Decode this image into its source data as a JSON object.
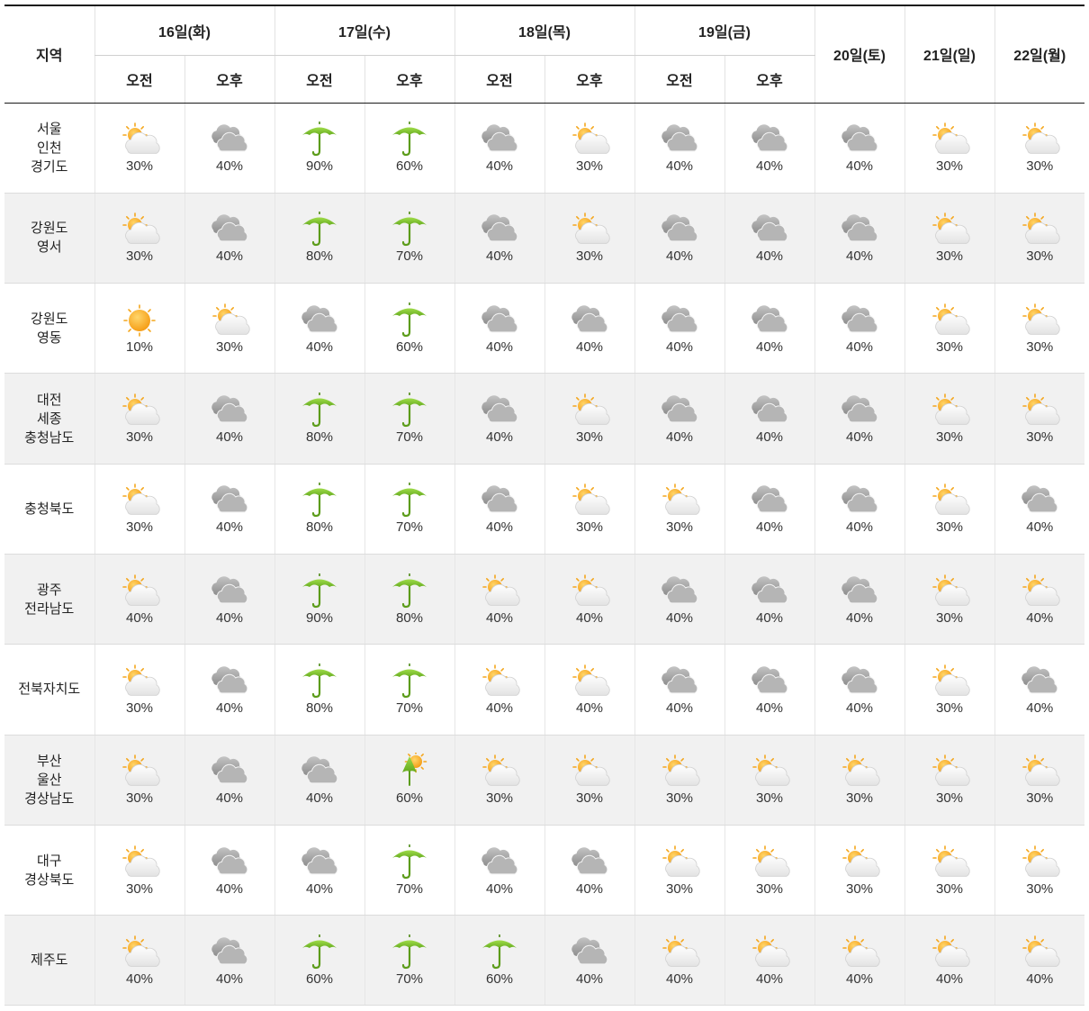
{
  "header": {
    "region_label": "지역",
    "days": [
      {
        "label": "16일(화)",
        "split": true
      },
      {
        "label": "17일(수)",
        "split": true
      },
      {
        "label": "18일(목)",
        "split": true
      },
      {
        "label": "19일(금)",
        "split": true
      },
      {
        "label": "20일(토)",
        "split": false
      },
      {
        "label": "21일(일)",
        "split": false
      },
      {
        "label": "22일(월)",
        "split": false
      }
    ],
    "am_label": "오전",
    "pm_label": "오후"
  },
  "icons": {
    "partly-cloudy": "partly-cloudy-icon",
    "cloudy": "cloudy-icon",
    "rain": "umbrella-icon",
    "sunny": "sun-icon",
    "shower": "umbrella-sun-icon"
  },
  "colors": {
    "header_rule": "#1a1a1a",
    "row_alt": "#f1f1f1",
    "umbrella_green": "#7dc42a",
    "sun_orange": "#f7a21b",
    "cloud_gray": "#a9a9a9"
  },
  "rows": [
    {
      "region": [
        "서울",
        "인천",
        "경기도"
      ],
      "cells": [
        {
          "icon": "partly-cloudy",
          "prob": "30%"
        },
        {
          "icon": "cloudy",
          "prob": "40%"
        },
        {
          "icon": "rain",
          "prob": "90%"
        },
        {
          "icon": "rain",
          "prob": "60%"
        },
        {
          "icon": "cloudy",
          "prob": "40%"
        },
        {
          "icon": "partly-cloudy",
          "prob": "30%"
        },
        {
          "icon": "cloudy",
          "prob": "40%"
        },
        {
          "icon": "cloudy",
          "prob": "40%"
        },
        {
          "icon": "cloudy",
          "prob": "40%"
        },
        {
          "icon": "partly-cloudy",
          "prob": "30%"
        },
        {
          "icon": "partly-cloudy",
          "prob": "30%"
        }
      ]
    },
    {
      "region": [
        "강원도",
        "영서"
      ],
      "cells": [
        {
          "icon": "partly-cloudy",
          "prob": "30%"
        },
        {
          "icon": "cloudy",
          "prob": "40%"
        },
        {
          "icon": "rain",
          "prob": "80%"
        },
        {
          "icon": "rain",
          "prob": "70%"
        },
        {
          "icon": "cloudy",
          "prob": "40%"
        },
        {
          "icon": "partly-cloudy",
          "prob": "30%"
        },
        {
          "icon": "cloudy",
          "prob": "40%"
        },
        {
          "icon": "cloudy",
          "prob": "40%"
        },
        {
          "icon": "cloudy",
          "prob": "40%"
        },
        {
          "icon": "partly-cloudy",
          "prob": "30%"
        },
        {
          "icon": "partly-cloudy",
          "prob": "30%"
        }
      ]
    },
    {
      "region": [
        "강원도",
        "영동"
      ],
      "cells": [
        {
          "icon": "sunny",
          "prob": "10%"
        },
        {
          "icon": "partly-cloudy",
          "prob": "30%"
        },
        {
          "icon": "cloudy",
          "prob": "40%"
        },
        {
          "icon": "rain",
          "prob": "60%"
        },
        {
          "icon": "cloudy",
          "prob": "40%"
        },
        {
          "icon": "cloudy",
          "prob": "40%"
        },
        {
          "icon": "cloudy",
          "prob": "40%"
        },
        {
          "icon": "cloudy",
          "prob": "40%"
        },
        {
          "icon": "cloudy",
          "prob": "40%"
        },
        {
          "icon": "partly-cloudy",
          "prob": "30%"
        },
        {
          "icon": "partly-cloudy",
          "prob": "30%"
        }
      ]
    },
    {
      "region": [
        "대전",
        "세종",
        "충청남도"
      ],
      "cells": [
        {
          "icon": "partly-cloudy",
          "prob": "30%"
        },
        {
          "icon": "cloudy",
          "prob": "40%"
        },
        {
          "icon": "rain",
          "prob": "80%"
        },
        {
          "icon": "rain",
          "prob": "70%"
        },
        {
          "icon": "cloudy",
          "prob": "40%"
        },
        {
          "icon": "partly-cloudy",
          "prob": "30%"
        },
        {
          "icon": "cloudy",
          "prob": "40%"
        },
        {
          "icon": "cloudy",
          "prob": "40%"
        },
        {
          "icon": "cloudy",
          "prob": "40%"
        },
        {
          "icon": "partly-cloudy",
          "prob": "30%"
        },
        {
          "icon": "partly-cloudy",
          "prob": "30%"
        }
      ]
    },
    {
      "region": [
        "충청북도"
      ],
      "cells": [
        {
          "icon": "partly-cloudy",
          "prob": "30%"
        },
        {
          "icon": "cloudy",
          "prob": "40%"
        },
        {
          "icon": "rain",
          "prob": "80%"
        },
        {
          "icon": "rain",
          "prob": "70%"
        },
        {
          "icon": "cloudy",
          "prob": "40%"
        },
        {
          "icon": "partly-cloudy",
          "prob": "30%"
        },
        {
          "icon": "partly-cloudy",
          "prob": "30%"
        },
        {
          "icon": "cloudy",
          "prob": "40%"
        },
        {
          "icon": "cloudy",
          "prob": "40%"
        },
        {
          "icon": "partly-cloudy",
          "prob": "30%"
        },
        {
          "icon": "cloudy",
          "prob": "40%"
        }
      ]
    },
    {
      "region": [
        "광주",
        "전라남도"
      ],
      "cells": [
        {
          "icon": "partly-cloudy",
          "prob": "40%"
        },
        {
          "icon": "cloudy",
          "prob": "40%"
        },
        {
          "icon": "rain",
          "prob": "90%"
        },
        {
          "icon": "rain",
          "prob": "80%"
        },
        {
          "icon": "partly-cloudy",
          "prob": "40%"
        },
        {
          "icon": "partly-cloudy",
          "prob": "40%"
        },
        {
          "icon": "cloudy",
          "prob": "40%"
        },
        {
          "icon": "cloudy",
          "prob": "40%"
        },
        {
          "icon": "cloudy",
          "prob": "40%"
        },
        {
          "icon": "partly-cloudy",
          "prob": "30%"
        },
        {
          "icon": "partly-cloudy",
          "prob": "40%"
        }
      ]
    },
    {
      "region": [
        "전북자치도"
      ],
      "cells": [
        {
          "icon": "partly-cloudy",
          "prob": "30%"
        },
        {
          "icon": "cloudy",
          "prob": "40%"
        },
        {
          "icon": "rain",
          "prob": "80%"
        },
        {
          "icon": "rain",
          "prob": "70%"
        },
        {
          "icon": "partly-cloudy",
          "prob": "40%"
        },
        {
          "icon": "partly-cloudy",
          "prob": "40%"
        },
        {
          "icon": "cloudy",
          "prob": "40%"
        },
        {
          "icon": "cloudy",
          "prob": "40%"
        },
        {
          "icon": "cloudy",
          "prob": "40%"
        },
        {
          "icon": "partly-cloudy",
          "prob": "30%"
        },
        {
          "icon": "cloudy",
          "prob": "40%"
        }
      ]
    },
    {
      "region": [
        "부산",
        "울산",
        "경상남도"
      ],
      "cells": [
        {
          "icon": "partly-cloudy",
          "prob": "30%"
        },
        {
          "icon": "cloudy",
          "prob": "40%"
        },
        {
          "icon": "cloudy",
          "prob": "40%"
        },
        {
          "icon": "shower",
          "prob": "60%"
        },
        {
          "icon": "partly-cloudy",
          "prob": "30%"
        },
        {
          "icon": "partly-cloudy",
          "prob": "30%"
        },
        {
          "icon": "partly-cloudy",
          "prob": "30%"
        },
        {
          "icon": "partly-cloudy",
          "prob": "30%"
        },
        {
          "icon": "partly-cloudy",
          "prob": "30%"
        },
        {
          "icon": "partly-cloudy",
          "prob": "30%"
        },
        {
          "icon": "partly-cloudy",
          "prob": "30%"
        }
      ]
    },
    {
      "region": [
        "대구",
        "경상북도"
      ],
      "cells": [
        {
          "icon": "partly-cloudy",
          "prob": "30%"
        },
        {
          "icon": "cloudy",
          "prob": "40%"
        },
        {
          "icon": "cloudy",
          "prob": "40%"
        },
        {
          "icon": "rain",
          "prob": "70%"
        },
        {
          "icon": "cloudy",
          "prob": "40%"
        },
        {
          "icon": "cloudy",
          "prob": "40%"
        },
        {
          "icon": "partly-cloudy",
          "prob": "30%"
        },
        {
          "icon": "partly-cloudy",
          "prob": "30%"
        },
        {
          "icon": "partly-cloudy",
          "prob": "30%"
        },
        {
          "icon": "partly-cloudy",
          "prob": "30%"
        },
        {
          "icon": "partly-cloudy",
          "prob": "30%"
        }
      ]
    },
    {
      "region": [
        "제주도"
      ],
      "cells": [
        {
          "icon": "partly-cloudy",
          "prob": "40%"
        },
        {
          "icon": "cloudy",
          "prob": "40%"
        },
        {
          "icon": "rain",
          "prob": "60%"
        },
        {
          "icon": "rain",
          "prob": "70%"
        },
        {
          "icon": "rain",
          "prob": "60%"
        },
        {
          "icon": "cloudy",
          "prob": "40%"
        },
        {
          "icon": "partly-cloudy",
          "prob": "40%"
        },
        {
          "icon": "partly-cloudy",
          "prob": "40%"
        },
        {
          "icon": "partly-cloudy",
          "prob": "40%"
        },
        {
          "icon": "partly-cloudy",
          "prob": "40%"
        },
        {
          "icon": "partly-cloudy",
          "prob": "40%"
        }
      ]
    }
  ]
}
